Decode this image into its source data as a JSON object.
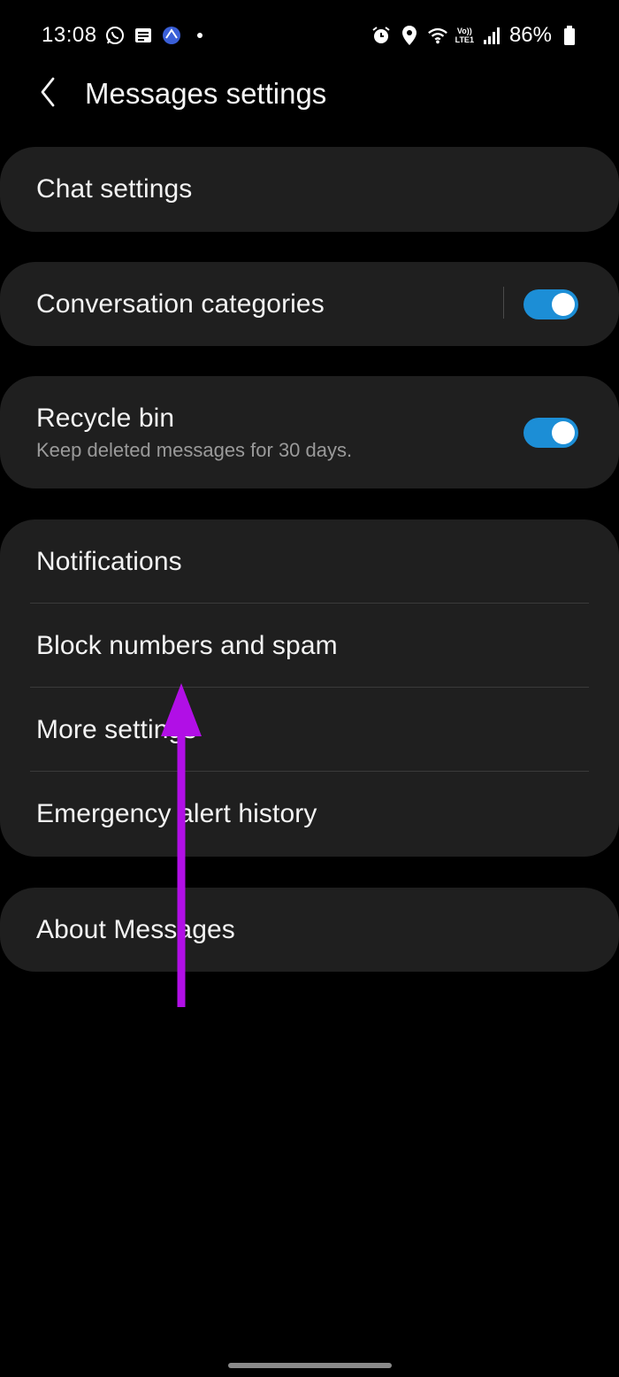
{
  "status_bar": {
    "time": "13:08",
    "battery": "86%",
    "lte_top": "Vo))",
    "lte_bottom": "LTE1",
    "left_icons": [
      "whatsapp-icon",
      "message-icon",
      "app-icon",
      "dot-icon"
    ],
    "right_icons": [
      "alarm-icon",
      "location-icon",
      "wifi-icon",
      "signal-icon",
      "battery-icon"
    ]
  },
  "header": {
    "title": "Messages settings",
    "back_icon": "chevron-left-icon"
  },
  "settings": {
    "chat_settings": "Chat settings",
    "conversation_categories": {
      "label": "Conversation categories",
      "enabled": true
    },
    "recycle_bin": {
      "label": "Recycle bin",
      "subtitle": "Keep deleted messages for 30 days.",
      "enabled": true
    },
    "group": [
      {
        "label": "Notifications"
      },
      {
        "label": "Block numbers and spam"
      },
      {
        "label": "More settings"
      },
      {
        "label": "Emergency alert history"
      }
    ],
    "about": "About Messages"
  },
  "colors": {
    "background": "#000000",
    "card": "#1f1f1f",
    "toggle_on": "#1c8ed6",
    "annotation_arrow": "#b10fe6"
  }
}
